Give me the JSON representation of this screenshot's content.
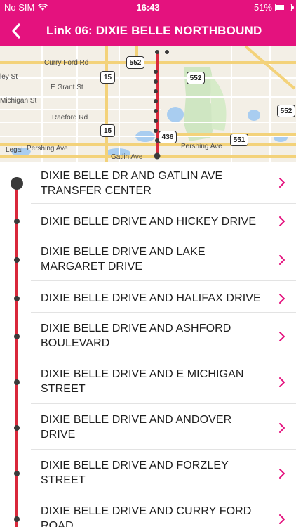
{
  "status_bar": {
    "carrier": "No SIM",
    "time": "16:43",
    "battery": "51%",
    "battery_level": 0.51
  },
  "nav": {
    "title": "Link 06: DIXIE BELLE NORTHBOUND"
  },
  "map": {
    "labels": {
      "curry_ford_rd": "Curry Ford Rd",
      "e_grant_st": "E Grant St",
      "michigan_st": "Michigan St",
      "raeford_rd": "Raeford Rd",
      "pershing_ave_left": "Pershing Ave",
      "pershing_ave_right": "Pershing Ave",
      "gatlin_ave": "Gatlin Ave",
      "legal": "Legal",
      "ley_st": "ley St"
    },
    "shields": {
      "s552_a": "552",
      "s552_b": "552",
      "s552_c": "552",
      "s15_a": "15",
      "s15_b": "15",
      "s436": "436",
      "s551": "551"
    }
  },
  "stops": [
    {
      "name": "DIXIE BELLE DR AND GATLIN AVE TRANSFER CENTER"
    },
    {
      "name": "DIXIE BELLE DRIVE AND HICKEY DRIVE"
    },
    {
      "name": "DIXIE BELLE DRIVE AND LAKE MARGARET DRIVE"
    },
    {
      "name": "DIXIE BELLE DRIVE AND HALIFAX DRIVE"
    },
    {
      "name": "DIXIE BELLE DRIVE AND ASHFORD BOULEVARD"
    },
    {
      "name": "DIXIE BELLE DRIVE AND E MICHIGAN STREET"
    },
    {
      "name": "DIXIE BELLE DRIVE AND ANDOVER DRIVE"
    },
    {
      "name": "DIXIE BELLE DRIVE AND FORZLEY STREET"
    },
    {
      "name": "DIXIE BELLE DRIVE AND CURRY FORD ROAD"
    }
  ],
  "colors": {
    "brand": "#e4127e",
    "route_line": "#d9283b",
    "chevron": "#e4127e",
    "stop_dot": "#3a3a3a"
  }
}
